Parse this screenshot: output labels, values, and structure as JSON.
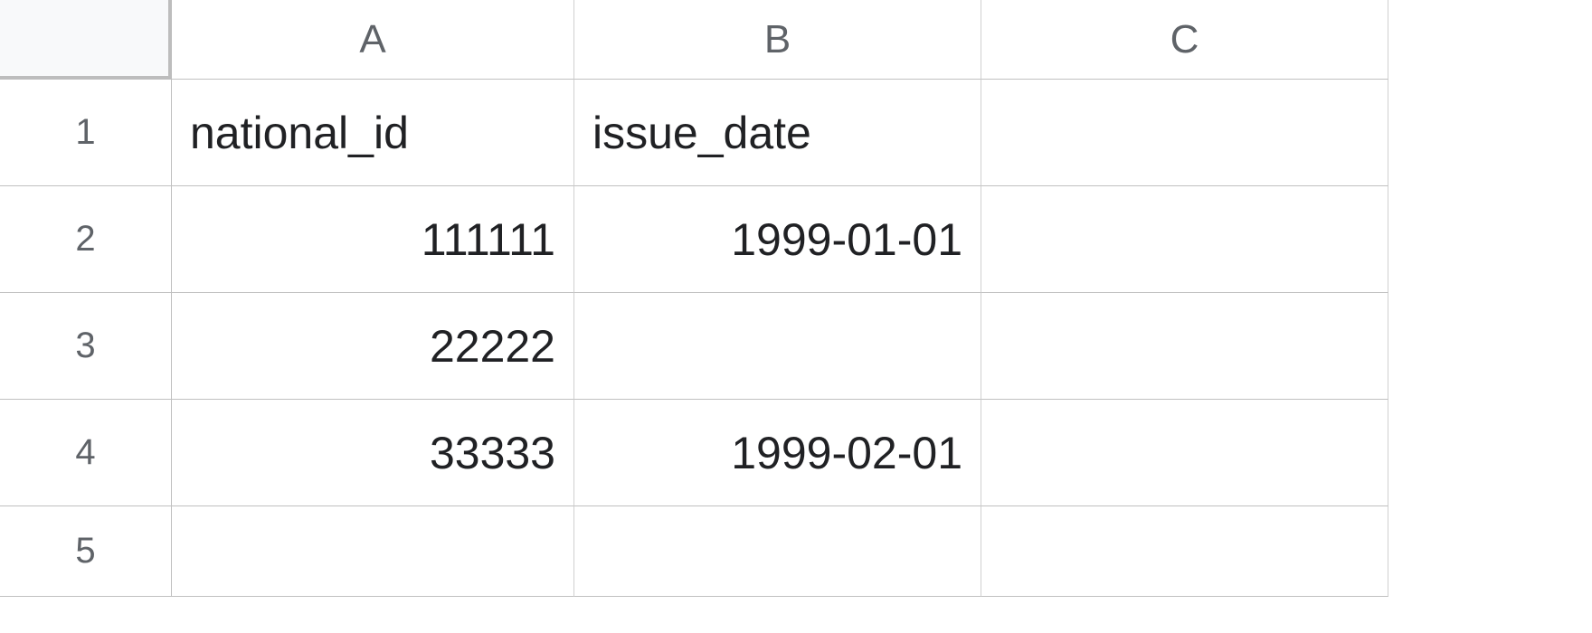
{
  "columns": [
    "A",
    "B",
    "C"
  ],
  "rowNumbers": [
    "1",
    "2",
    "3",
    "4",
    "5"
  ],
  "cells": {
    "A1": "national_id",
    "B1": "issue_date",
    "C1": "",
    "A2": "111111",
    "B2": "1999-01-01",
    "C2": "",
    "A3": "22222",
    "B3": "",
    "C3": "",
    "A4": "33333",
    "B4": "1999-02-01",
    "C4": "",
    "A5": "",
    "B5": "",
    "C5": ""
  }
}
